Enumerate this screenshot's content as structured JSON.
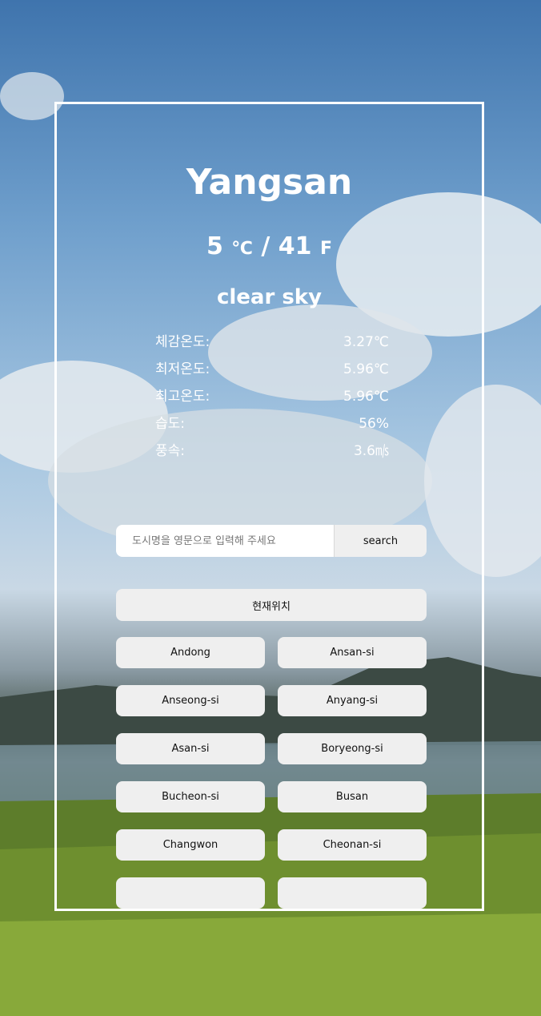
{
  "weather": {
    "city": "Yangsan",
    "temp_c": "5",
    "unit_c": "℃",
    "separator": "/",
    "temp_f": "41",
    "unit_f": "F",
    "description": "clear sky"
  },
  "details": [
    {
      "label": "체감온도:",
      "value": "3.27℃"
    },
    {
      "label": "최저온도:",
      "value": "5.96℃"
    },
    {
      "label": "최고온도:",
      "value": "5.96℃"
    },
    {
      "label": "습도:",
      "value": "56%"
    },
    {
      "label": "풍속:",
      "value": "3.6㎧"
    }
  ],
  "search": {
    "placeholder": "도시명을 영문으로 입력해 주세요",
    "button_label": "search"
  },
  "current_location_label": "현재위치",
  "cities": [
    "Andong",
    "Ansan-si",
    "Anseong-si",
    "Anyang-si",
    "Asan-si",
    "Boryeong-si",
    "Bucheon-si",
    "Busan",
    "Changwon",
    "Cheonan-si"
  ]
}
